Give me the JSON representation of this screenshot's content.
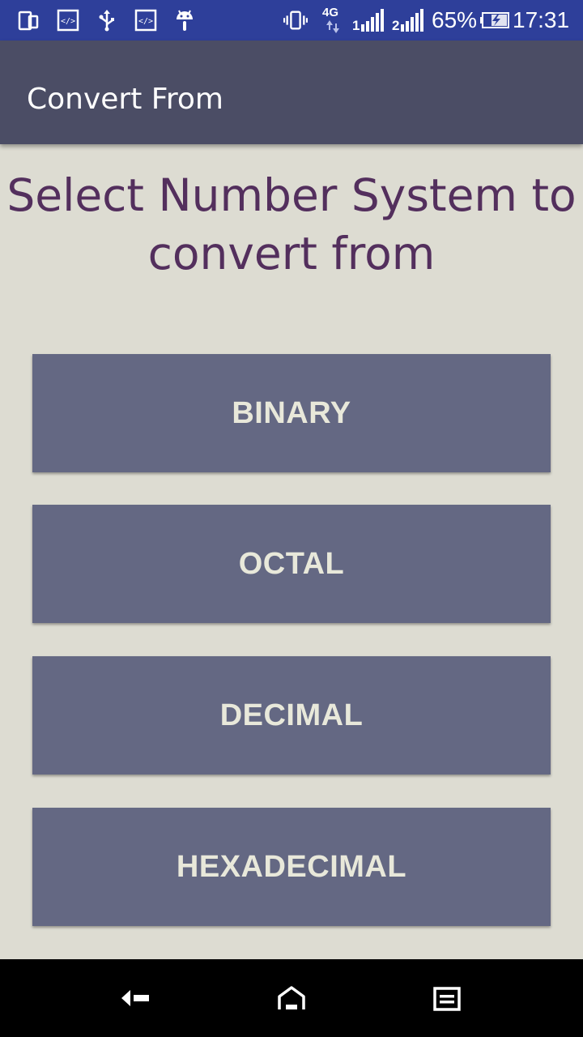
{
  "status_bar": {
    "battery_percent": "65%",
    "time": "17:31",
    "network": "4G",
    "sim1": "1",
    "sim2": "2",
    "icons": [
      "device-icon",
      "code-icon",
      "usb-icon",
      "code-icon",
      "android-icon",
      "vibrate-icon",
      "signal-icon",
      "signal-icon",
      "battery-charging-icon"
    ]
  },
  "app_bar": {
    "title": "Convert From"
  },
  "main": {
    "heading": "Select Number System to convert from",
    "options": [
      {
        "label": "BINARY"
      },
      {
        "label": "OCTAL"
      },
      {
        "label": "DECIMAL"
      },
      {
        "label": "HEXADECIMAL"
      }
    ]
  },
  "nav_bar": {
    "icons": [
      "back-icon",
      "home-icon",
      "recents-icon"
    ]
  },
  "colors": {
    "status_bar": "#2e3f9a",
    "app_bar": "#4b4d65",
    "background": "#dddcd2",
    "heading": "#532f5d",
    "button": "#646883",
    "button_text": "#e8e8da"
  }
}
